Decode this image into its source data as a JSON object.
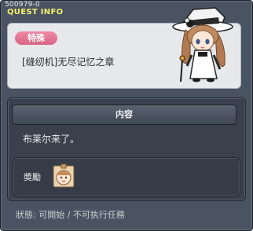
{
  "window": {
    "quest_id": "500979-0",
    "title": "QUEST INFO"
  },
  "quest": {
    "category": "特殊",
    "name": "[缝纫机]无尽记忆之章",
    "npc_icon": "npc-lady-portrait-icon"
  },
  "content": {
    "header": "内容",
    "description": "布莱尔来了。",
    "reward_label": "奬勵",
    "reward_item_icon": "face-doll-icon"
  },
  "status": {
    "text": "狀態:  可開始  /  不可执行任務"
  },
  "colors": {
    "title": "#f6f06e",
    "badge": "#d76585",
    "panel": "#4a5361"
  }
}
